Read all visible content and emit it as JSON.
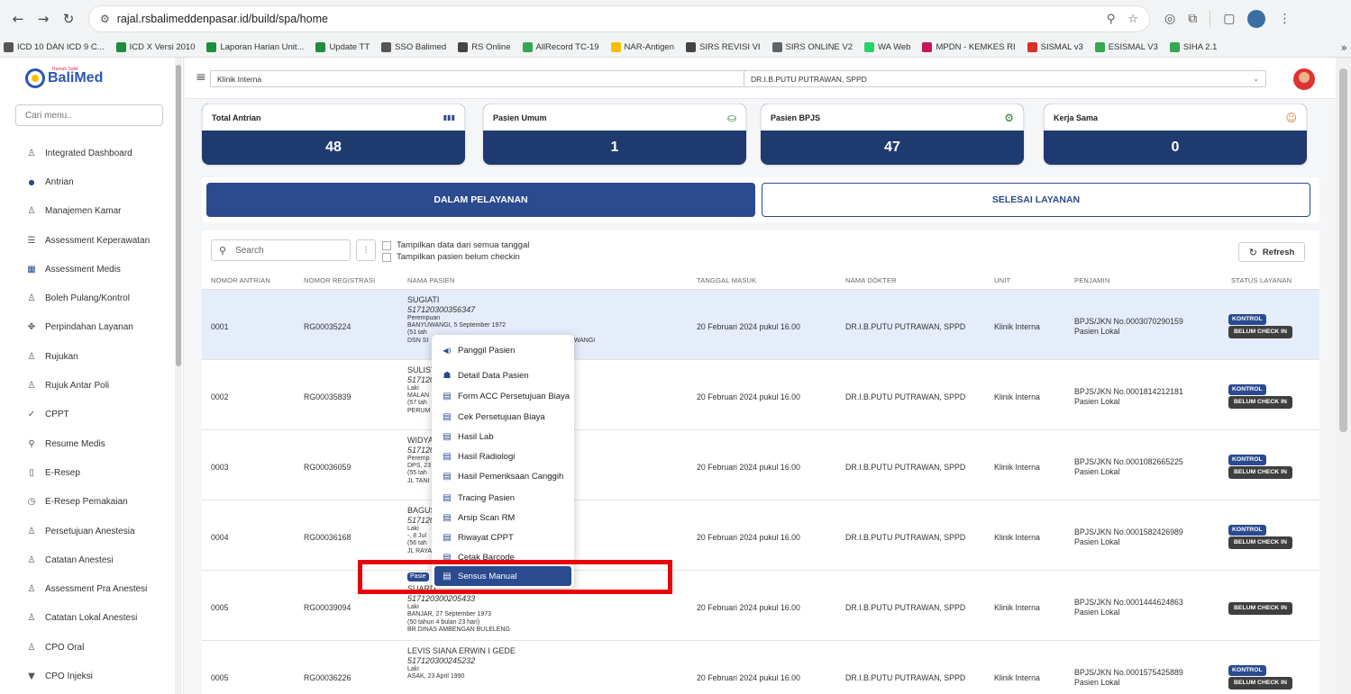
{
  "browser": {
    "url": "rajal.rsbalimeddenpasar.id/build/spa/home",
    "bookmarks": [
      "ICD 10 DAN ICD 9 C...",
      "ICD X Versi 2010",
      "Laporan Harian Unit...",
      "Update TT",
      "SSO Balimed",
      "RS Online",
      "AllRecord TC-19",
      "NAR-Antigen",
      "SIRS REVISI VI",
      "SIRS ONLINE V2",
      "WA Web",
      "MPDN - KEMKES RI",
      "SISMAL v3",
      "ESISMAL V3",
      "SIHA 2.1"
    ],
    "bookmark_colors": [
      "#555",
      "#1e8e3e",
      "#1e8e3e",
      "#1e8e3e",
      "#555",
      "#444",
      "#34a853",
      "#fbbc04",
      "#444",
      "#5f6368",
      "#25d366",
      "#c2185b",
      "#d93025",
      "#34a853",
      "#34a853"
    ]
  },
  "app": {
    "logo": "BaliMed",
    "logo_sub": "Rumah Sakit",
    "search_placeholder": "Cari menu..",
    "menu": [
      {
        "label": "Integrated Dashboard",
        "icon": "user-icon"
      },
      {
        "label": "Antrian",
        "icon": "dot-icon"
      },
      {
        "label": "Manajemen Kamar",
        "icon": "user-icon"
      },
      {
        "label": "Assessment Keperawatan",
        "icon": "list-icon"
      },
      {
        "label": "Assessment Medis",
        "icon": "grid-icon"
      },
      {
        "label": "Boleh Pulang/Kontrol",
        "icon": "user-icon"
      },
      {
        "label": "Perpindahan Layanan",
        "icon": "move-icon"
      },
      {
        "label": "Rujukan",
        "icon": "user-icon"
      },
      {
        "label": "Rujuk Antar Poli",
        "icon": "user-icon"
      },
      {
        "label": "CPPT",
        "icon": "check-icon"
      },
      {
        "label": "Resume Medis",
        "icon": "search-icon"
      },
      {
        "label": "E-Resep",
        "icon": "book-icon"
      },
      {
        "label": "E-Resep Pemakaian",
        "icon": "clock-icon"
      },
      {
        "label": "Persetujuan Anestesia",
        "icon": "user-icon"
      },
      {
        "label": "Catatan Anestesi",
        "icon": "user-icon"
      },
      {
        "label": "Assessment Pra Anestesi",
        "icon": "user-icon"
      },
      {
        "label": "Catatan Lokal Anestesi",
        "icon": "user-icon"
      },
      {
        "label": "CPO Oral",
        "icon": "user-icon"
      },
      {
        "label": "CPO Injeksi",
        "icon": "filter-icon"
      }
    ]
  },
  "topbar": {
    "unit": "Klinik Interna",
    "doctor": "DR.I.B.PUTU PUTRAWAN, SPPD"
  },
  "stats": [
    {
      "label": "Total Antrian",
      "value": "48",
      "icon": "bars-icon"
    },
    {
      "label": "Pasien Umum",
      "value": "1",
      "icon": "bed-icon"
    },
    {
      "label": "Pasien BPJS",
      "value": "47",
      "icon": "gear-icon"
    },
    {
      "label": "Kerja Sama",
      "value": "0",
      "icon": "people-icon"
    }
  ],
  "tabs": {
    "active": "DALAM PELAYANAN",
    "other": "SELESAI LAYANAN"
  },
  "table": {
    "search_placeholder": "Search",
    "check1": "Tampilkan data dari semua tanggal",
    "check2": "Tampilkan pasien belum checkin",
    "refresh": "Refresh",
    "headers": [
      "NOMOR ANTRIAN",
      "NOMOR REGISTRASI",
      "NAMA PASIEN",
      "TANGGAL MASUK",
      "NAMA DOKTER",
      "UNIT",
      "PENJAMIN",
      "STATUS LAYANAN"
    ],
    "rows": [
      {
        "no": "0001",
        "reg": "RG00035224",
        "name": "SUGIATI",
        "rm": "5171203003563​47",
        "lines": [
          "Perempuan",
          "BANYUWANGI, 5 September 1972",
          "(51 tah",
          "DSN SI                                                              CAR BANYUWANGI"
        ],
        "tgl": "20 Februari 2024 pukul 16.00",
        "dokter": "DR.I.B.PUTU PUTRAWAN, SPPD",
        "unit": "Klinik Interna",
        "penjamin": "BPJS/JKN No.0003070290159",
        "penjamin2": "Pasien Lokal",
        "kontrol": "KONTROL",
        "status": "BELUM CHECK IN"
      },
      {
        "no": "0002",
        "reg": "RG00035839",
        "name": "SULIST",
        "rm": "517120",
        "lines": [
          "Laki",
          "MALAN",
          "(57 tah",
          "PERUM"
        ],
        "tgl": "20 Februari 2024 pukul 16.00",
        "dokter": "DR.I.B.PUTU PUTRAWAN, SPPD",
        "unit": "Klinik Interna",
        "penjamin": "BPJS/JKN No.0001814212181",
        "penjamin2": "Pasien Lokal",
        "kontrol": "KONTROL",
        "status": "BELUM CHECK IN"
      },
      {
        "no": "0003",
        "reg": "RG00036059",
        "name": "WIDYA",
        "rm": "517120",
        "lines": [
          "Peremp",
          "DPS, 23",
          "(55 tah",
          "JL TANI"
        ],
        "tgl": "20 Februari 2024 pukul 16.00",
        "dokter": "DR.I.B.PUTU PUTRAWAN, SPPD",
        "unit": "Klinik Interna",
        "penjamin": "BPJS/JKN No.0001082665225",
        "penjamin2": "Pasien Lokal",
        "kontrol": "KONTROL",
        "status": "BELUM CHECK IN"
      },
      {
        "no": "0004",
        "reg": "RG00036168",
        "name": "BAGUS",
        "rm": "517120",
        "lines": [
          "Laki",
          "-, 8 Jul",
          "(56 tah",
          "JL RAYA"
        ],
        "tgl": "20 Februari 2024 pukul 16.00",
        "dokter": "DR.I.B.PUTU PUTRAWAN, SPPD",
        "unit": "Klinik Interna",
        "penjamin": "BPJS/JKN No.0001582426989",
        "penjamin2": "Pasien Lokal",
        "kontrol": "KONTROL",
        "status": "BELUM CHECK IN"
      },
      {
        "no": "0005",
        "reg": "RG00039094",
        "name": "SUARD",
        "badge": "Pasie",
        "rm": "517120300205433",
        "lines": [
          "Laki",
          "BANJAR, 27 September 1973",
          "(50 tahun 4 bulan 23 hari)",
          "BR DINAS AMBENGAN BULELENG"
        ],
        "tgl": "20 Februari 2024 pukul 16.00",
        "dokter": "DR.I.B.PUTU PUTRAWAN, SPPD",
        "unit": "Klinik Interna",
        "penjamin": "BPJS/JKN No.0001444624863",
        "penjamin2": "Pasien Lokal",
        "kontrol": "",
        "status": "BELUM CHECK IN"
      },
      {
        "no": "0005",
        "reg": "RG00036226",
        "name": "LEVIS SIANA ERWIN I GEDE",
        "rm": "517120300245232",
        "lines": [
          "Laki",
          "ASAK, 23 April 1990"
        ],
        "tgl": "20 Februari 2024 pukul 16.00",
        "dokter": "DR.I.B.PUTU PUTRAWAN, SPPD",
        "unit": "Klinik Interna",
        "penjamin": "BPJS/JKN No.0001575425889",
        "penjamin2": "Pasien Lokal",
        "kontrol": "KONTROL",
        "status": "BELUM CHECK IN"
      }
    ]
  },
  "context_menu": [
    "Panggil Pasien",
    "Detail Data Pasien",
    "Form ACC Persetujuan Biaya",
    "Cek Persetujuan Biaya",
    "Hasil Lab",
    "Hasil Radiologi",
    "Hasil Pemeriksaan Canggih",
    "Tracing Pasien",
    "Arsip Scan RM",
    "Riwayat CPPT",
    "Cetak Barcode",
    "Sensus Manual"
  ],
  "context_active": "Sensus Manual",
  "colors": {
    "primary": "#2b4a8f",
    "stat_bg": "#1f3a6e",
    "highlight_box": "#e8000b"
  }
}
